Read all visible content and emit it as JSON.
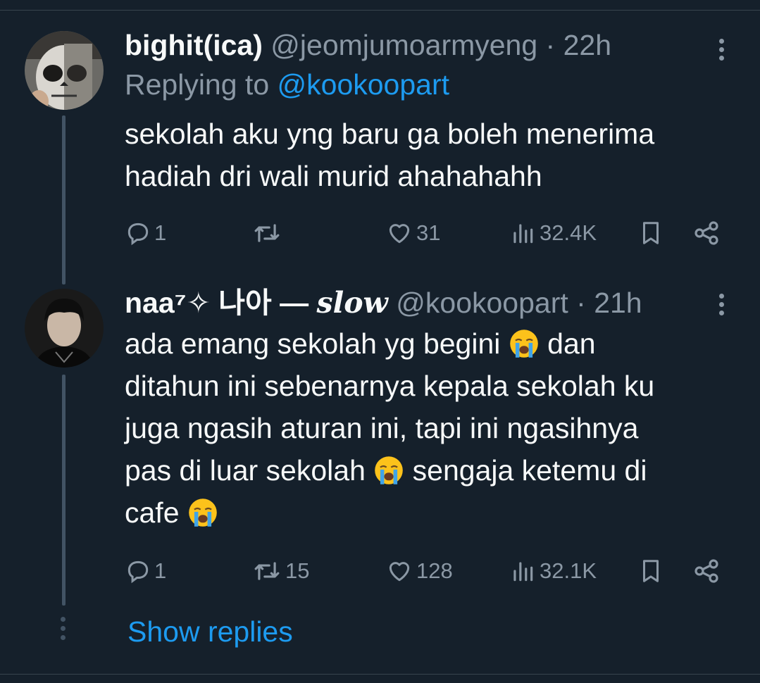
{
  "tweets": [
    {
      "name": "bighit(ica)",
      "handle": "@jeomjumoarmyeng",
      "dot": " · ",
      "time": "22h",
      "replying_prefix": "Replying to ",
      "replying_to": "@kookoopart",
      "lines": [
        "sekolah aku yng baru ga boleh menerima",
        "hadiah dri wali murid ahahahahh"
      ],
      "replies": "1",
      "retweets": "",
      "likes": "31",
      "views": "32.4K"
    },
    {
      "name": "naa⁷✧ 나아 — ",
      "name_italic": "slow",
      "handle": "@kookoopart",
      "dot": " · ",
      "time": "21h",
      "line1a": "ada emang sekolah yg begini ",
      "line1b": " dan",
      "line2": "ditahun ini sebenarnya kepala sekolah ku",
      "line3": "juga ngasih aturan ini, tapi ini ngasihnya",
      "line4a": "pas di luar sekolah ",
      "line4b": " sengaja ketemu di",
      "line5a": "cafe ",
      "replies": "1",
      "retweets": "15",
      "likes": "128",
      "views": "32.1K"
    }
  ],
  "show_replies": "Show replies",
  "icons": [
    "reply-icon",
    "retweet-icon",
    "like-icon",
    "views-icon",
    "bookmark-icon",
    "share-icon",
    "more-icon",
    "loudly-crying-emoji"
  ],
  "colors": {
    "background": "#15202b",
    "accent": "#1d9bf0",
    "muted": "#8b98a5",
    "thread": "#425364"
  }
}
